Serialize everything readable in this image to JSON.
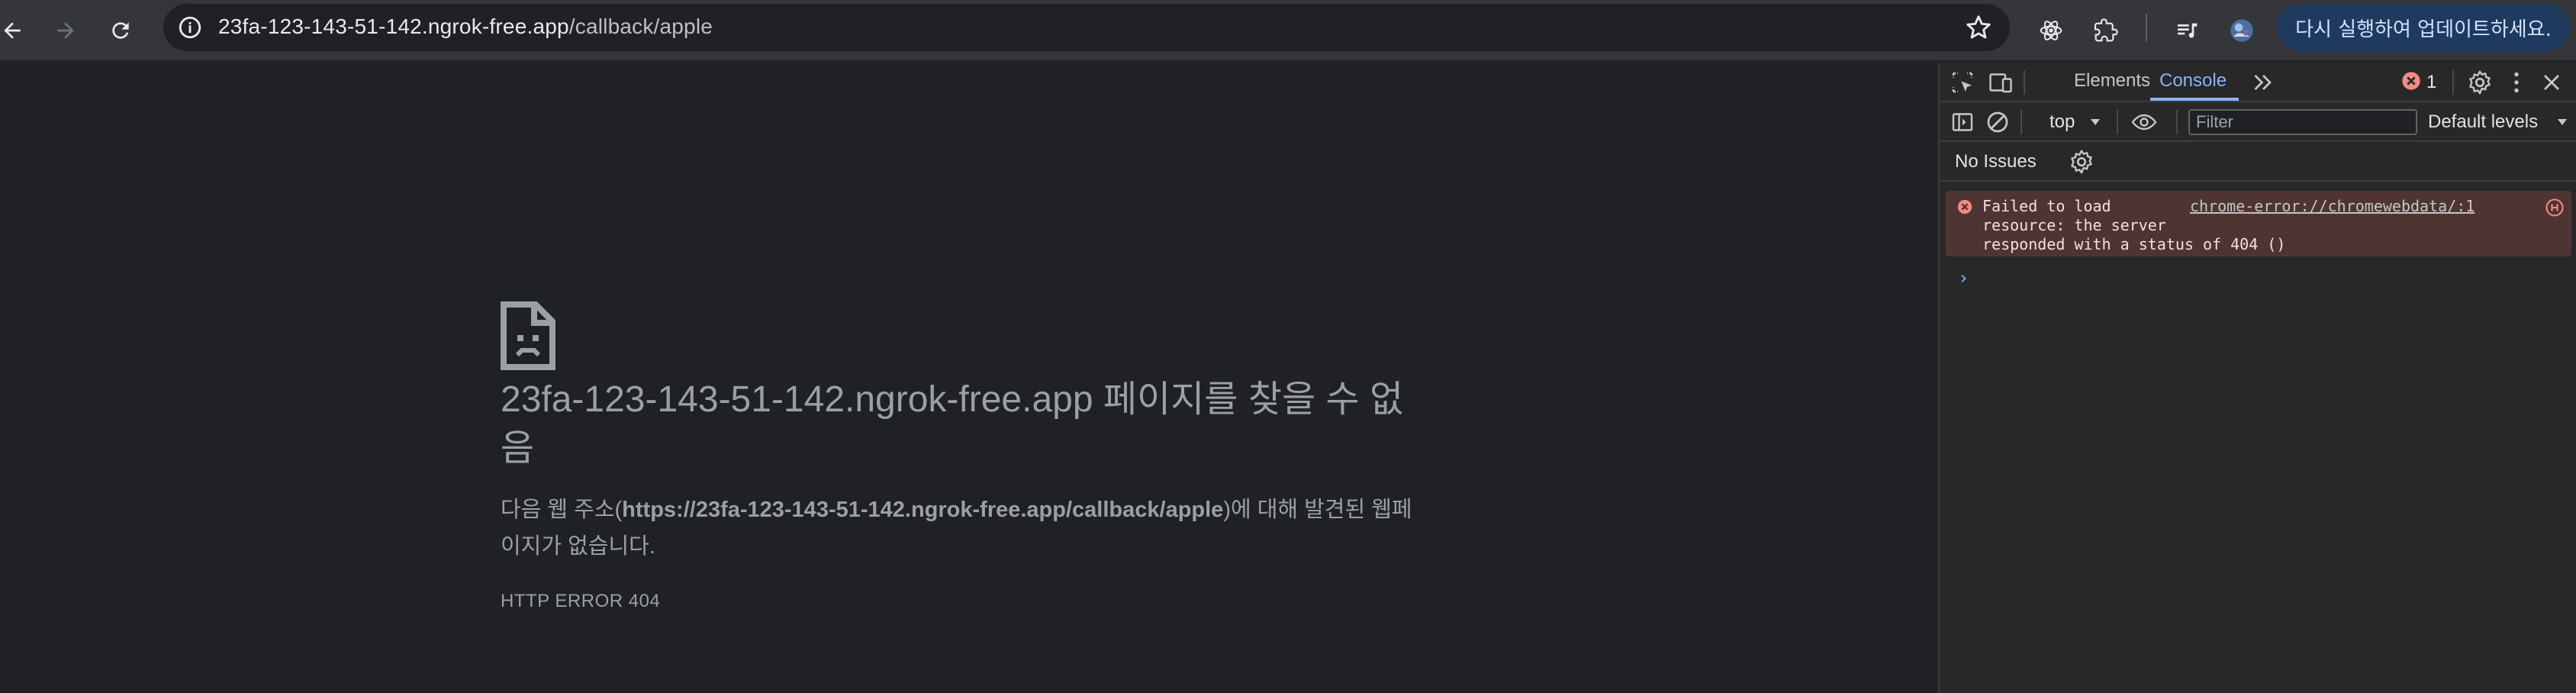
{
  "browser": {
    "url_host": "23fa-123-143-51-142.ngrok-free.app",
    "url_path": "/callback/apple",
    "update_button": "다시 실행하여 업데이트하세요."
  },
  "page": {
    "title": "23fa-123-143-51-142.ngrok-free.app 페이지를 찾을 수 없음",
    "desc_prefix": "다음 웹 주소(",
    "desc_url": "https://23fa-123-143-51-142.ngrok-free.app/callback/apple",
    "desc_suffix": ")에 대해 발견된 웹페이지가 없습니다.",
    "error_code": "HTTP ERROR 404"
  },
  "devtools": {
    "tabs": [
      "Elements",
      "Console"
    ],
    "active_tab": "Console",
    "error_count": "1",
    "context": "top",
    "filter_placeholder": "Filter",
    "levels": "Default levels",
    "issues": "No Issues",
    "console_error": {
      "message": "Failed to load\nresource: the server\nresponded with a status of 404 ()",
      "source": "chrome-error://chromewebdata/:1"
    },
    "prompt": "›"
  },
  "colors": {
    "page_bg": "#202124",
    "toolbar_bg": "#35363a",
    "accent": "#8ab4f8",
    "error_red": "#f28b82",
    "error_bg": "#4e3534"
  },
  "icons": [
    "back-icon",
    "forward-icon",
    "reload-icon",
    "info-icon",
    "star-icon",
    "react-icon",
    "extensions-icon",
    "media-icon",
    "profile-avatar",
    "sad-page-icon",
    "inspect-icon",
    "device-icon",
    "more-tabs-icon",
    "error-icon",
    "settings-icon",
    "kebab-icon",
    "close-icon",
    "sidebar-icon",
    "clear-icon",
    "eye-icon",
    "chevron-down-icon"
  ]
}
